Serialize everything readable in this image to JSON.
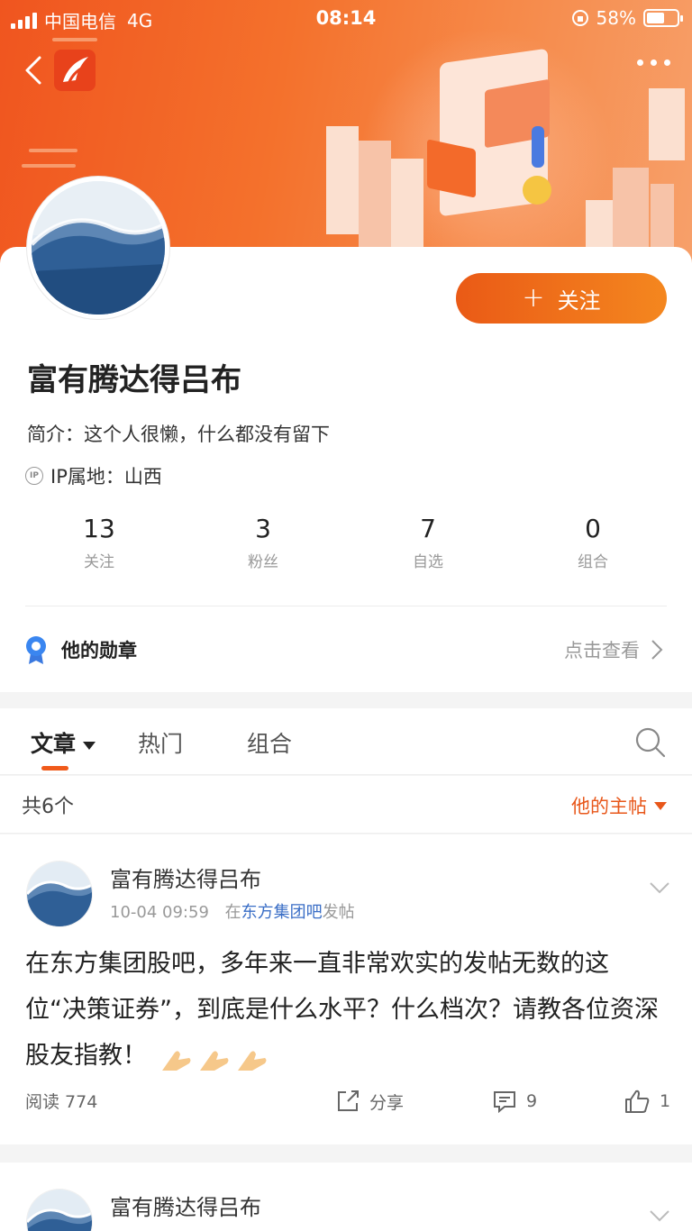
{
  "status_bar": {
    "carrier": "中国电信",
    "network": "4G",
    "time": "08:14",
    "battery": "58%"
  },
  "profile": {
    "name": "富有腾达得吕布",
    "bio": "简介：这个人很懒，什么都没有留下",
    "ip_location": "IP属地：山西",
    "follow_label": "关注",
    "stats": [
      {
        "num": "13",
        "label": "关注"
      },
      {
        "num": "3",
        "label": "粉丝"
      },
      {
        "num": "7",
        "label": "自选"
      },
      {
        "num": "0",
        "label": "组合"
      }
    ],
    "medals_label": "他的勋章",
    "medals_link": "点击查看"
  },
  "tabs": {
    "items": [
      "文章",
      "热门",
      "组合"
    ]
  },
  "list": {
    "count": "共6个",
    "filter": "他的主帖"
  },
  "posts": [
    {
      "author": "富有腾达得吕布",
      "time": "10-04 09:59",
      "meta_prefix": "在",
      "board": "东方集团吧",
      "meta_suffix": "发帖",
      "body": "在东方集团股吧，多年来一直非常欢实的发帖无数的这位“决策证券”，到底是什么水平？什么档次？请教各位资深股友指教！",
      "reads": "阅读 774",
      "share": "分享",
      "comments": "9",
      "likes": "1"
    },
    {
      "author": "富有腾达得吕布"
    }
  ],
  "colors": {
    "accent": "#f05a1a",
    "link": "#3a6ec6"
  }
}
